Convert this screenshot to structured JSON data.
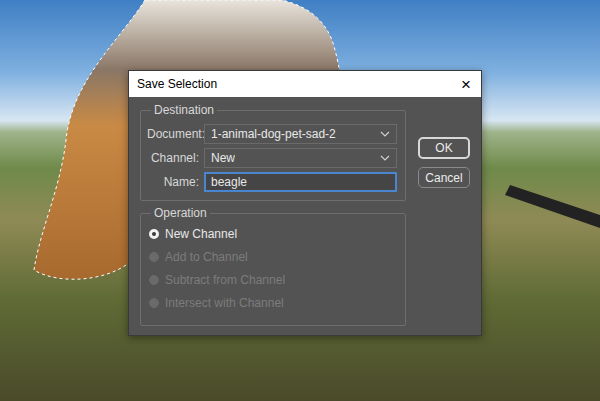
{
  "window": {
    "title": "Save Selection",
    "close": "×"
  },
  "destination": {
    "label": "Destination",
    "fields": [
      {
        "label": "Document:",
        "value": "1-animal-dog-pet-sad-2",
        "kind": "select",
        "focused": false
      },
      {
        "label": "Channel:",
        "value": "New",
        "kind": "select",
        "focused": false
      },
      {
        "label": "Name:",
        "value": "beagle",
        "kind": "text",
        "focused": true
      }
    ]
  },
  "operation": {
    "label": "Operation",
    "options": [
      {
        "label": "New Channel",
        "selected": true,
        "disabled": false
      },
      {
        "label": "Add to Channel",
        "selected": false,
        "disabled": true
      },
      {
        "label": "Subtract from Channel",
        "selected": false,
        "disabled": true
      },
      {
        "label": "Intersect with Channel",
        "selected": false,
        "disabled": true
      }
    ]
  },
  "buttons": [
    {
      "label": "OK",
      "default": true
    },
    {
      "label": "Cancel",
      "default": false
    }
  ]
}
